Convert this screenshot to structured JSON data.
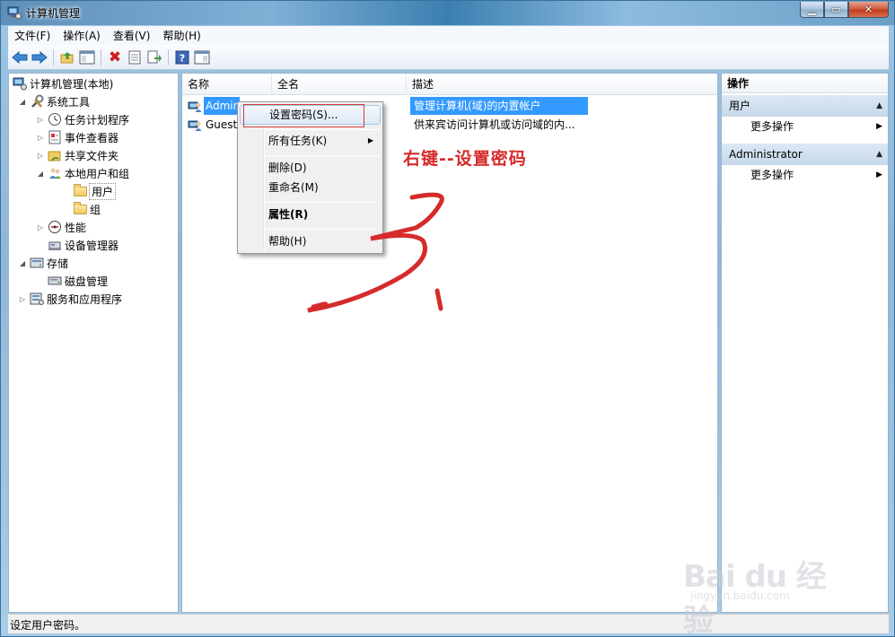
{
  "window": {
    "title": "计算机管理"
  },
  "menubar": [
    "文件(F)",
    "操作(A)",
    "查看(V)",
    "帮助(H)"
  ],
  "tree": [
    {
      "label": "计算机管理(本地)",
      "icon": "computer-management-icon",
      "level": 0,
      "twisty": ""
    },
    {
      "label": "系统工具",
      "icon": "tools-icon",
      "level": 1,
      "twisty": "open"
    },
    {
      "label": "任务计划程序",
      "icon": "clock-icon",
      "level": 2,
      "twisty": "closed"
    },
    {
      "label": "事件查看器",
      "icon": "event-viewer-icon",
      "level": 2,
      "twisty": "closed"
    },
    {
      "label": "共享文件夹",
      "icon": "shared-folder-icon",
      "level": 2,
      "twisty": "closed"
    },
    {
      "label": "本地用户和组",
      "icon": "users-icon",
      "level": 2,
      "twisty": "open"
    },
    {
      "label": "用户",
      "icon": "folder-icon",
      "level": 3,
      "twisty": ""
    },
    {
      "label": "组",
      "icon": "folder-icon",
      "level": 3,
      "twisty": ""
    },
    {
      "label": "性能",
      "icon": "performance-icon",
      "level": 2,
      "twisty": "closed"
    },
    {
      "label": "设备管理器",
      "icon": "device-manager-icon",
      "level": 2,
      "twisty": ""
    },
    {
      "label": "存储",
      "icon": "storage-icon",
      "level": 1,
      "twisty": "open"
    },
    {
      "label": "磁盘管理",
      "icon": "disk-icon",
      "level": 2,
      "twisty": ""
    },
    {
      "label": "服务和应用程序",
      "icon": "services-icon",
      "level": 1,
      "twisty": "closed"
    }
  ],
  "list": {
    "columns": [
      "名称",
      "全名",
      "描述"
    ],
    "rows": [
      {
        "name": "Administrator",
        "fullname": "",
        "desc": "管理计算机(域)的内置帐户",
        "selected": true
      },
      {
        "name": "Guest",
        "fullname": "",
        "desc": "供来宾访问计算机或访问域的内..."
      }
    ]
  },
  "context_menu": {
    "set_password": "设置密码(S)...",
    "all_tasks": "所有任务(K)",
    "delete": "删除(D)",
    "rename": "重命名(M)",
    "properties": "属性(R)",
    "help": "帮助(H)"
  },
  "annotation": {
    "text": "右键--设置密码",
    "color": "#d62b2b"
  },
  "actions": {
    "title": "操作",
    "group1": "用户",
    "group1_more": "更多操作",
    "group2": "Administrator",
    "group2_more": "更多操作"
  },
  "status": "设定用户密码。",
  "watermark": {
    "main": "Bai du 经验",
    "sub": "jingyan.baidu.com"
  },
  "colors": {
    "selection": "#3399ff",
    "annotation": "#d62b2b"
  }
}
